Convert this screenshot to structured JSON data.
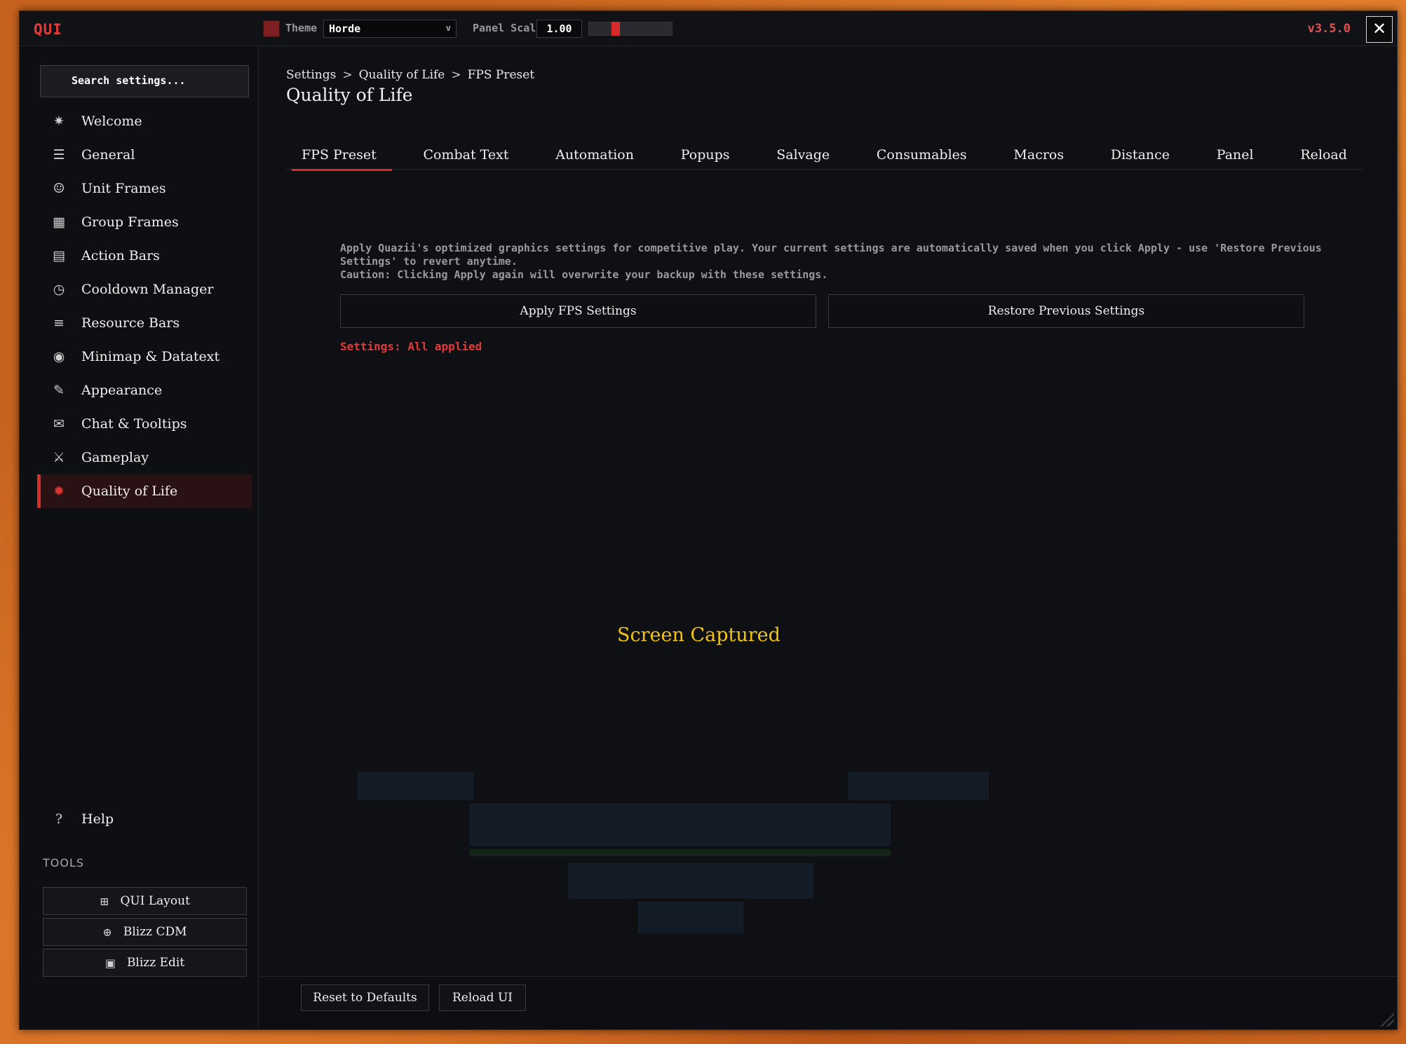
{
  "topbar": {
    "logo": "QUI",
    "theme_label": "Theme",
    "theme_value": "Horde",
    "theme_swatch_color": "#7d1f22",
    "scale_label": "Panel Scale:",
    "scale_value": "1.00",
    "version": "v3.5.0",
    "close_icon": "✕"
  },
  "sidebar": {
    "search_placeholder": "Search settings...",
    "items": [
      {
        "label": "Welcome",
        "icon": "✷",
        "icon_name": "compass-icon"
      },
      {
        "label": "General",
        "icon": "☰",
        "icon_name": "sliders-icon"
      },
      {
        "label": "Unit Frames",
        "icon": "☺",
        "icon_name": "user-icon"
      },
      {
        "label": "Group Frames",
        "icon": "▦",
        "icon_name": "group-icon"
      },
      {
        "label": "Action Bars",
        "icon": "▤",
        "icon_name": "action-bars-icon"
      },
      {
        "label": "Cooldown Manager",
        "icon": "◷",
        "icon_name": "cooldown-icon"
      },
      {
        "label": "Resource Bars",
        "icon": "≡",
        "icon_name": "resource-bars-icon"
      },
      {
        "label": "Minimap & Datatext",
        "icon": "◉",
        "icon_name": "minimap-icon"
      },
      {
        "label": "Appearance",
        "icon": "✎",
        "icon_name": "brush-icon"
      },
      {
        "label": "Chat & Tooltips",
        "icon": "✉",
        "icon_name": "chat-icon"
      },
      {
        "label": "Gameplay",
        "icon": "⚔",
        "icon_name": "swords-icon"
      },
      {
        "label": "Quality of Life",
        "icon": "✹",
        "icon_name": "gear-icon"
      }
    ],
    "active_index": 11,
    "help": {
      "label": "Help",
      "icon": "?"
    },
    "tools_label": "TOOLS",
    "tools": [
      {
        "label": "QUI Layout",
        "icon": "⊞"
      },
      {
        "label": "Blizz CDM",
        "icon": "⊕"
      },
      {
        "label": "Blizz Edit",
        "icon": "▣"
      }
    ]
  },
  "main": {
    "breadcrumb": [
      "Settings",
      "Quality of Life",
      "FPS Preset"
    ],
    "breadcrumb_sep": ">",
    "title": "Quality of Life",
    "tabs": [
      "FPS Preset",
      "Combat Text",
      "Automation",
      "Popups",
      "Salvage",
      "Consumables",
      "Macros",
      "Distance",
      "Panel",
      "Reload"
    ],
    "active_tab": 0,
    "description_line1": "Apply Quazii's optimized graphics settings for competitive play. Your current settings are automatically saved when you click Apply - use 'Restore Previous Settings' to revert anytime.",
    "description_line2": "Caution: Clicking Apply again will overwrite your backup with these settings.",
    "apply_button": "Apply FPS Settings",
    "restore_button": "Restore Previous Settings",
    "status": "Settings: All applied",
    "overlay_message": "Screen Captured"
  },
  "footer": {
    "reset_button": "Reset to Defaults",
    "reload_button": "Reload UI"
  },
  "colors": {
    "accent": "#d92a2a",
    "status_red": "#e03a3a",
    "overlay_yellow": "#f0c419",
    "panel_bg": "#0f1013"
  }
}
